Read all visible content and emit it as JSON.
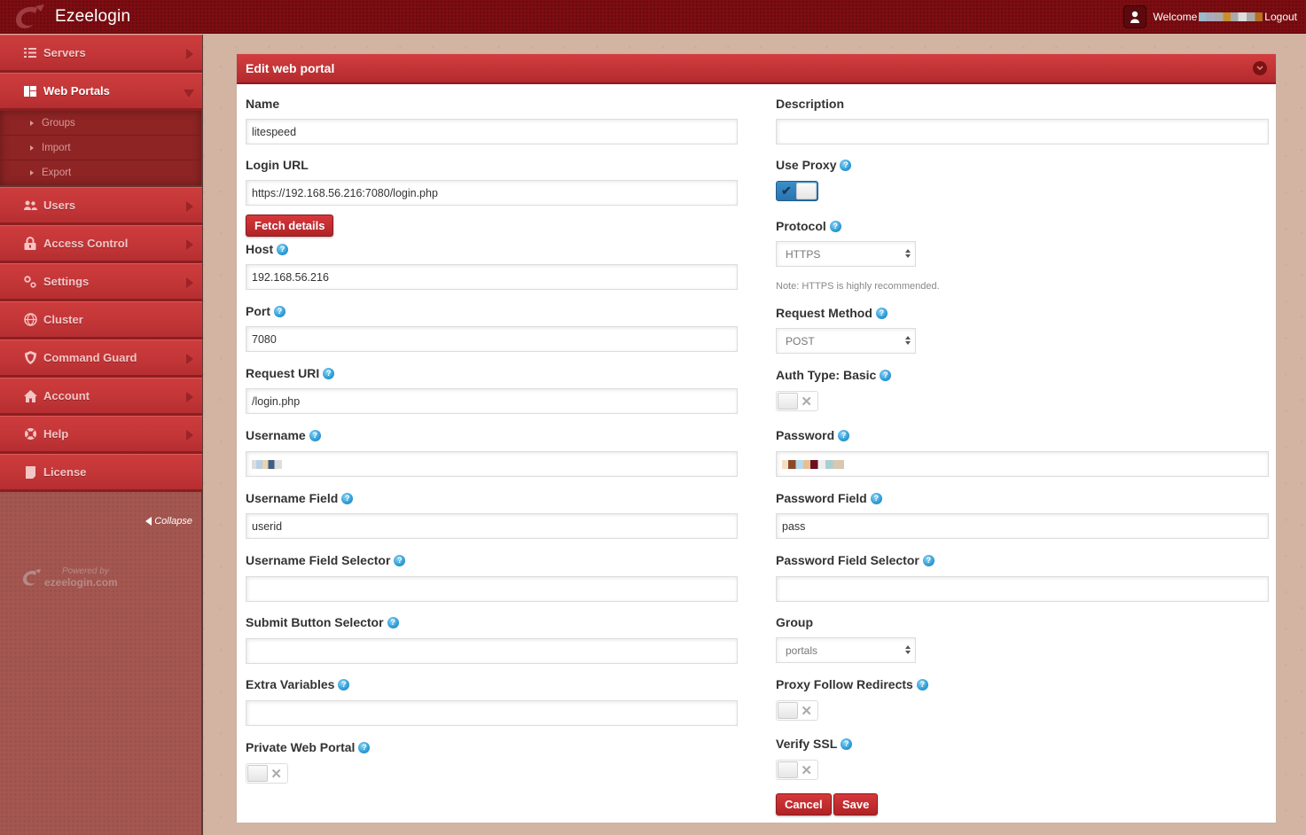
{
  "app": {
    "title": "Ezeelogin",
    "welcome_text": "Welcome",
    "logout_label": "Logout"
  },
  "sidebar": {
    "items": [
      {
        "label": "Servers",
        "icon": "list-icon",
        "has_arrow": true
      },
      {
        "label": "Web Portals",
        "icon": "dashboard-icon",
        "expanded": true
      },
      {
        "label": "Users",
        "icon": "users-icon",
        "has_arrow": true
      },
      {
        "label": "Access Control",
        "icon": "lock-icon",
        "has_arrow": true
      },
      {
        "label": "Settings",
        "icon": "gears-icon",
        "has_arrow": true
      },
      {
        "label": "Cluster",
        "icon": "globe-icon",
        "has_arrow": false
      },
      {
        "label": "Command Guard",
        "icon": "shield-icon",
        "has_arrow": true
      },
      {
        "label": "Account",
        "icon": "home-icon",
        "has_arrow": true
      },
      {
        "label": "Help",
        "icon": "lifebuoy-icon",
        "has_arrow": true
      },
      {
        "label": "License",
        "icon": "document-icon",
        "has_arrow": false
      }
    ],
    "subitems": [
      {
        "label": "Groups"
      },
      {
        "label": "Import"
      },
      {
        "label": "Export"
      }
    ],
    "collapse_label": "Collapse",
    "powered_by": "Powered by",
    "powered_domain": "ezeelogin.com"
  },
  "panel": {
    "title": "Edit web portal",
    "left": {
      "name": {
        "label": "Name",
        "value": "litespeed"
      },
      "login_url": {
        "label": "Login URL",
        "value": "https://192.168.56.216:7080/login.php"
      },
      "fetch_button": "Fetch details",
      "host": {
        "label": "Host",
        "value": "192.168.56.216"
      },
      "port": {
        "label": "Port",
        "value": "7080"
      },
      "request_uri": {
        "label": "Request URI",
        "value": "/login.php"
      },
      "username": {
        "label": "Username",
        "value": ""
      },
      "username_field": {
        "label": "Username Field",
        "value": "userid"
      },
      "username_field_selector": {
        "label": "Username Field Selector",
        "value": ""
      },
      "submit_button_selector": {
        "label": "Submit Button Selector",
        "value": ""
      },
      "extra_variables": {
        "label": "Extra Variables",
        "value": ""
      },
      "private_web_portal": {
        "label": "Private Web Portal",
        "enabled": false
      }
    },
    "right": {
      "description": {
        "label": "Description",
        "value": ""
      },
      "use_proxy": {
        "label": "Use Proxy",
        "enabled": true
      },
      "protocol": {
        "label": "Protocol",
        "selected": "HTTPS",
        "note": "Note: HTTPS is highly recommended."
      },
      "request_method": {
        "label": "Request Method",
        "selected": "POST"
      },
      "auth_type_basic": {
        "label": "Auth Type: Basic",
        "enabled": false
      },
      "password": {
        "label": "Password",
        "value": ""
      },
      "password_field": {
        "label": "Password Field",
        "value": "pass"
      },
      "password_field_selector": {
        "label": "Password Field Selector",
        "value": ""
      },
      "group": {
        "label": "Group",
        "selected": "portals"
      },
      "proxy_follow_redirects": {
        "label": "Proxy Follow Redirects",
        "enabled": false
      },
      "verify_ssl": {
        "label": "Verify SSL",
        "enabled": false
      },
      "cancel_button": "Cancel",
      "save_button": "Save"
    }
  },
  "colors": {
    "brand_red": "#c23537",
    "topbar": "#7d0d12",
    "toggle_on": "#2a73ad",
    "help_icon": "#2d9bd6"
  }
}
